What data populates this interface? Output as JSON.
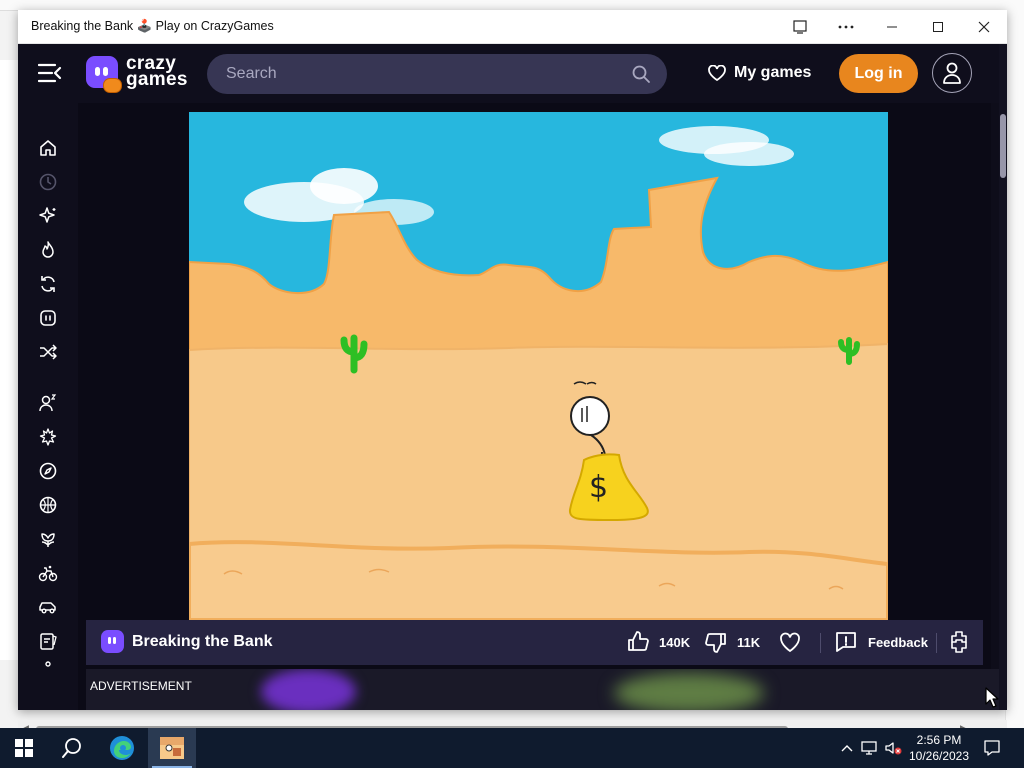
{
  "window": {
    "title": "Breaking the Bank 🕹️ Play on CrazyGames"
  },
  "header": {
    "logo_line1": "crazy",
    "logo_line2": "games",
    "search_placeholder": "Search",
    "my_games": "My games",
    "login": "Log in"
  },
  "sidebar": {
    "items": [
      "home-icon",
      "recent-icon",
      "new-icon",
      "trending-icon",
      "updated-icon",
      "originals-icon",
      "random-icon",
      "multiplayer-icon",
      "action-icon",
      "adventure-icon",
      "basketball-icon",
      "flower-icon",
      "bike-icon",
      "car-icon",
      "card-icon",
      "more-icon"
    ]
  },
  "game": {
    "title": "Breaking the Bank",
    "likes": "140K",
    "dislikes": "11K",
    "feedback": "Feedback",
    "money_symbol": "$"
  },
  "ad": {
    "label": "ADVERTISEMENT"
  },
  "taskbar": {
    "time": "2:56 PM",
    "date": "10/26/2023"
  },
  "colors": {
    "accent": "#7a4dff",
    "login": "#e8861e",
    "header_bg": "#0f0e1c",
    "game_bar": "#262441",
    "sky": "#27b7de",
    "sand": "#f7c98a",
    "taskbar": "#0f1b2e"
  }
}
